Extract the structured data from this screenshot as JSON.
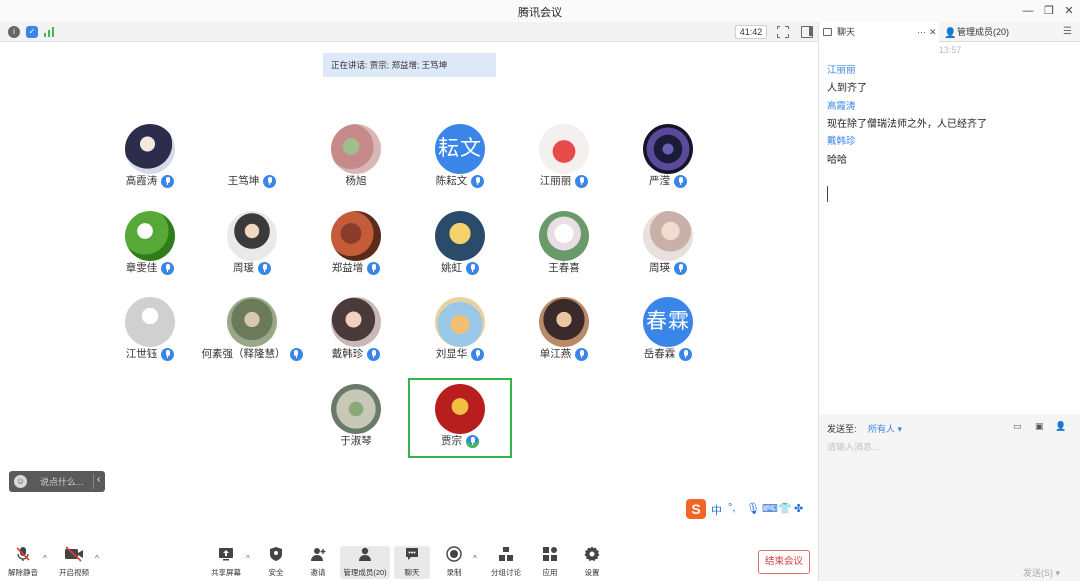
{
  "window": {
    "title": "腾讯会议"
  },
  "topbar": {
    "timer": "41:42"
  },
  "speaking": "正在讲话: 贾宗; 郑益增; 王笃坤",
  "participants": [
    {
      "name": "高霞涛",
      "mic": true,
      "avatar": "photo"
    },
    {
      "name": "王笃坤",
      "mic": true,
      "avatar": "photo"
    },
    {
      "name": "杨旭",
      "mic": false,
      "avatar": "photo"
    },
    {
      "name": "陈耘文",
      "mic": true,
      "avatar": "text",
      "initials": "耘文",
      "color": "#3a86e8"
    },
    {
      "name": "江丽丽",
      "mic": true,
      "avatar": "photo"
    },
    {
      "name": "严滢",
      "mic": true,
      "avatar": "photo"
    },
    {
      "name": "章雯佳",
      "mic": true,
      "avatar": "photo"
    },
    {
      "name": "周瑗",
      "mic": true,
      "avatar": "photo"
    },
    {
      "name": "郑益增",
      "mic": true,
      "avatar": "photo"
    },
    {
      "name": "姚虹",
      "mic": true,
      "avatar": "photo"
    },
    {
      "name": "王春喜",
      "mic": false,
      "avatar": "photo"
    },
    {
      "name": "周瑛",
      "mic": true,
      "avatar": "photo"
    },
    {
      "name": "江世钰",
      "mic": true,
      "avatar": "default"
    },
    {
      "name": "何素强（释隆慧）",
      "mic": true,
      "avatar": "photo"
    },
    {
      "name": "戴韩珍",
      "mic": true,
      "avatar": "photo"
    },
    {
      "name": "刘显华",
      "mic": true,
      "avatar": "photo"
    },
    {
      "name": "单江燕",
      "mic": true,
      "avatar": "photo"
    },
    {
      "name": "岳春霖",
      "mic": true,
      "avatar": "text",
      "initials": "春霖",
      "color": "#3a86e8"
    },
    {
      "name": "于淑琴",
      "mic": false,
      "avatar": "photo"
    },
    {
      "name": "贾宗",
      "mic": true,
      "avatar": "photo",
      "active": true
    }
  ],
  "chat_input": {
    "placeholder": "说点什么..."
  },
  "ime": {
    "lang": "中"
  },
  "toolbar": {
    "unmute": "解除静音",
    "video": "开启视频",
    "share": "共享屏幕",
    "security": "安全",
    "invite": "邀请",
    "members": "管理成员(20)",
    "chat": "聊天",
    "record": "录制",
    "breakout": "分组讨论",
    "apps": "应用",
    "settings": "设置",
    "end": "结束会议"
  },
  "panel": {
    "tab_chat": "聊天",
    "tab_members": "管理成员(20)",
    "timestamp": "13:57",
    "messages": [
      {
        "sender": "江丽丽",
        "text": "人到齐了"
      },
      {
        "sender": "高霞涛",
        "text": "现在除了僧瑞法师之外，人已经齐了"
      },
      {
        "sender": "戴韩珍",
        "text": "哈哈"
      }
    ],
    "send_to_label": "发送至:",
    "send_to_value": "所有人",
    "input_placeholder": "请输入消息...",
    "send_button": "发送(S)"
  }
}
